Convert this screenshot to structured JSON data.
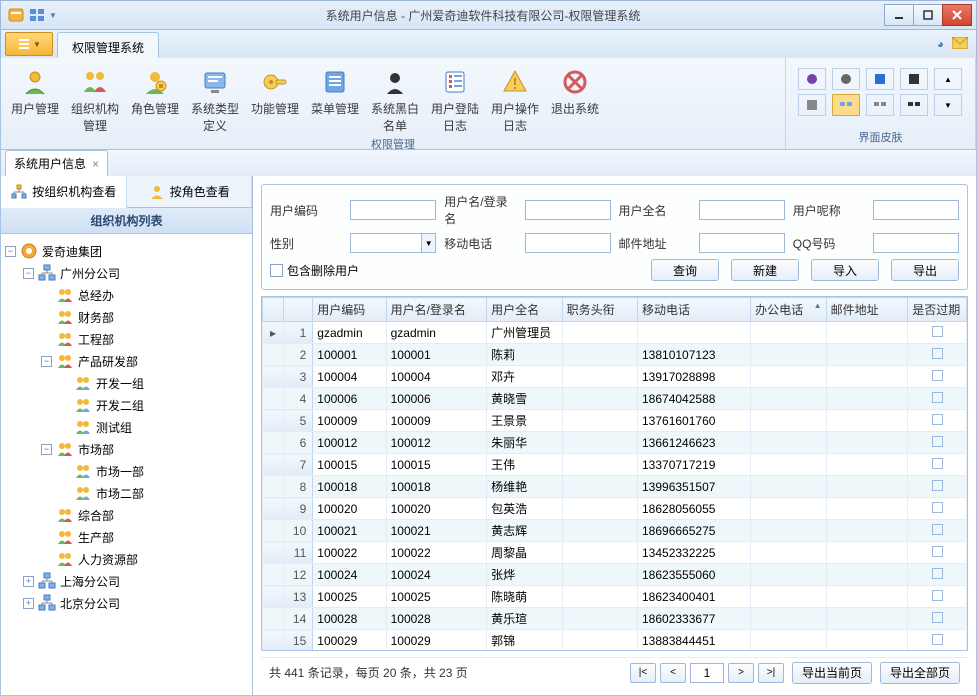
{
  "window": {
    "title": "系统用户信息 - 广州爱奇迪软件科技有限公司-权限管理系统"
  },
  "menutab": "权限管理系统",
  "ribbon": {
    "group1_caption": "权限管理",
    "group2_caption": "界面皮肤",
    "buttons": [
      {
        "label": "用户管理",
        "icon": "user"
      },
      {
        "label": "组织机构管理",
        "icon": "org"
      },
      {
        "label": "角色管理",
        "icon": "role"
      },
      {
        "label": "系统类型定义",
        "icon": "systype"
      },
      {
        "label": "功能管理",
        "icon": "func"
      },
      {
        "label": "菜单管理",
        "icon": "menu"
      },
      {
        "label": "系统黑白名单",
        "icon": "bw"
      },
      {
        "label": "用户登陆日志",
        "icon": "loginlog"
      },
      {
        "label": "用户操作日志",
        "icon": "oplog"
      },
      {
        "label": "退出系统",
        "icon": "exit"
      }
    ]
  },
  "doctab": {
    "label": "系统用户信息"
  },
  "left": {
    "tab_org": "按组织机构查看",
    "tab_role": "按角色查看",
    "header": "组织机构列表",
    "tree": [
      {
        "level": 0,
        "expand": "-",
        "icon": "root",
        "label": "爱奇迪集团"
      },
      {
        "level": 1,
        "expand": "-",
        "icon": "branch",
        "label": "广州分公司"
      },
      {
        "level": 2,
        "expand": "",
        "icon": "dept",
        "label": "总经办"
      },
      {
        "level": 2,
        "expand": "",
        "icon": "dept",
        "label": "财务部"
      },
      {
        "level": 2,
        "expand": "",
        "icon": "dept",
        "label": "工程部"
      },
      {
        "level": 2,
        "expand": "-",
        "icon": "dept",
        "label": "产品研发部"
      },
      {
        "level": 3,
        "expand": "",
        "icon": "team",
        "label": "开发一组"
      },
      {
        "level": 3,
        "expand": "",
        "icon": "team",
        "label": "开发二组"
      },
      {
        "level": 3,
        "expand": "",
        "icon": "team",
        "label": "测试组"
      },
      {
        "level": 2,
        "expand": "-",
        "icon": "dept",
        "label": "市场部"
      },
      {
        "level": 3,
        "expand": "",
        "icon": "team",
        "label": "市场一部"
      },
      {
        "level": 3,
        "expand": "",
        "icon": "team",
        "label": "市场二部"
      },
      {
        "level": 2,
        "expand": "",
        "icon": "dept",
        "label": "综合部"
      },
      {
        "level": 2,
        "expand": "",
        "icon": "dept",
        "label": "生产部"
      },
      {
        "level": 2,
        "expand": "",
        "icon": "dept",
        "label": "人力资源部"
      },
      {
        "level": 1,
        "expand": "+",
        "icon": "branch",
        "label": "上海分公司"
      },
      {
        "level": 1,
        "expand": "+",
        "icon": "branch",
        "label": "北京分公司"
      }
    ]
  },
  "search": {
    "labels": {
      "code": "用户编码",
      "login": "用户名/登录名",
      "fullname": "用户全名",
      "nick": "用户呢称",
      "gender": "性别",
      "mobile": "移动电话",
      "email": "邮件地址",
      "qq": "QQ号码"
    },
    "include_deleted": "包含删除用户",
    "btn_query": "查询",
    "btn_new": "新建",
    "btn_import": "导入",
    "btn_export": "导出"
  },
  "grid": {
    "columns": [
      "用户编码",
      "用户名/登录名",
      "用户全名",
      "职务头衔",
      "移动电话",
      "办公电话",
      "邮件地址",
      "是否过期"
    ],
    "rows": [
      {
        "n": 1,
        "code": "gzadmin",
        "login": "gzadmin",
        "name": "广州管理员",
        "title": "",
        "mobile": ""
      },
      {
        "n": 2,
        "code": "100001",
        "login": "100001",
        "name": "陈莉",
        "title": "",
        "mobile": "13810107123"
      },
      {
        "n": 3,
        "code": "100004",
        "login": "100004",
        "name": "邓卉",
        "title": "",
        "mobile": "13917028898"
      },
      {
        "n": 4,
        "code": "100006",
        "login": "100006",
        "name": "黄晓雪",
        "title": "",
        "mobile": "18674042588"
      },
      {
        "n": 5,
        "code": "100009",
        "login": "100009",
        "name": "王景景",
        "title": "",
        "mobile": "13761601760"
      },
      {
        "n": 6,
        "code": "100012",
        "login": "100012",
        "name": "朱丽华",
        "title": "",
        "mobile": "13661246623"
      },
      {
        "n": 7,
        "code": "100015",
        "login": "100015",
        "name": "王伟",
        "title": "",
        "mobile": "13370717219"
      },
      {
        "n": 8,
        "code": "100018",
        "login": "100018",
        "name": "杨维艳",
        "title": "",
        "mobile": "13996351507"
      },
      {
        "n": 9,
        "code": "100020",
        "login": "100020",
        "name": "包英浩",
        "title": "",
        "mobile": "18628056055"
      },
      {
        "n": 10,
        "code": "100021",
        "login": "100021",
        "name": "黄志辉",
        "title": "",
        "mobile": "18696665275"
      },
      {
        "n": 11,
        "code": "100022",
        "login": "100022",
        "name": "周黎晶",
        "title": "",
        "mobile": "13452332225"
      },
      {
        "n": 12,
        "code": "100024",
        "login": "100024",
        "name": "张烨",
        "title": "",
        "mobile": "18623555060"
      },
      {
        "n": 13,
        "code": "100025",
        "login": "100025",
        "name": "陈晓萌",
        "title": "",
        "mobile": "18623400401"
      },
      {
        "n": 14,
        "code": "100028",
        "login": "100028",
        "name": "黄乐瑄",
        "title": "",
        "mobile": "18602333677"
      },
      {
        "n": 15,
        "code": "100029",
        "login": "100029",
        "name": "郭锦",
        "title": "",
        "mobile": "13883844451"
      }
    ]
  },
  "footer": {
    "summary": "共 441 条记录，每页 20 条，共 23 页",
    "page": "1",
    "btn_export_page": "导出当前页",
    "btn_export_all": "导出全部页"
  }
}
